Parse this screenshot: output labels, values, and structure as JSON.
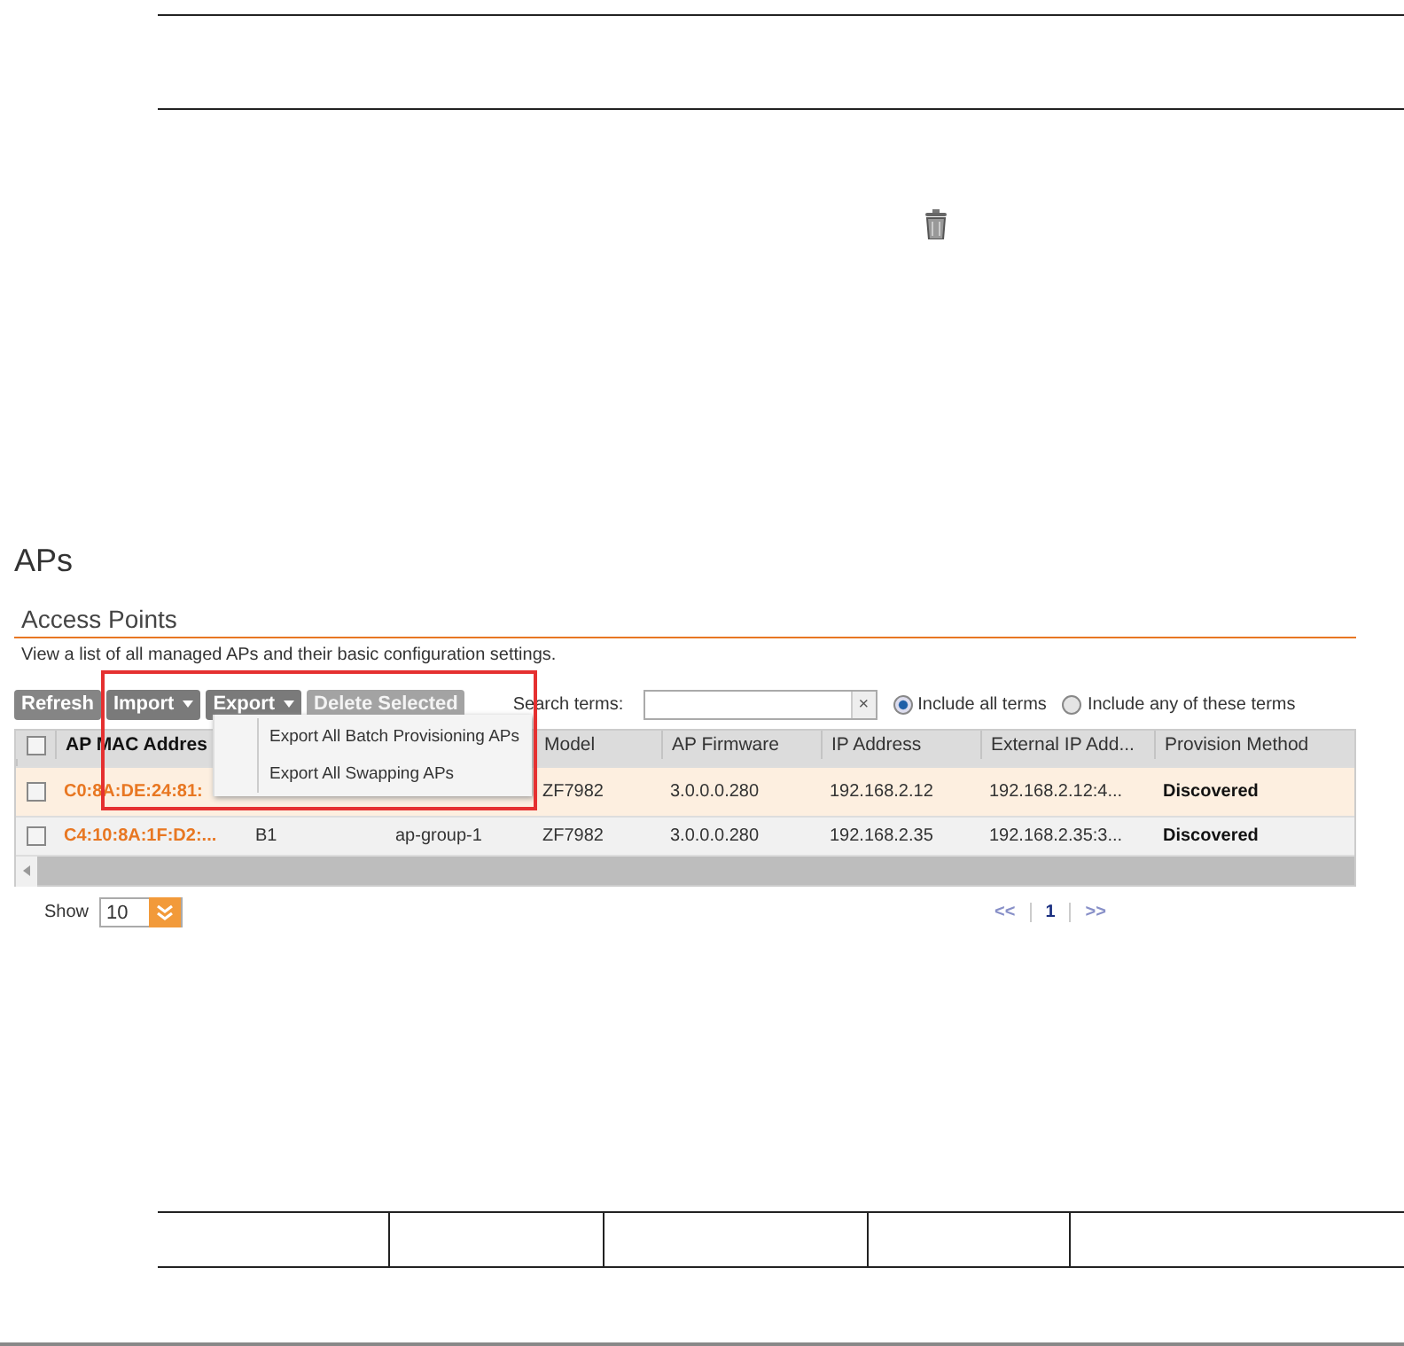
{
  "page_title": "APs",
  "section": {
    "title": "Access Points",
    "description": "View a list of all managed APs and their basic configuration settings."
  },
  "toolbar": {
    "buttons": [
      {
        "label": "Refresh",
        "has_menu": false,
        "disabled": false
      },
      {
        "label": "Import",
        "has_menu": true,
        "disabled": false
      },
      {
        "label": "Export",
        "has_menu": true,
        "disabled": false
      },
      {
        "label": "Delete Selected",
        "has_menu": false,
        "disabled": true
      }
    ],
    "search_label": "Search terms:",
    "clear": "×",
    "options": [
      {
        "label": "Include all terms",
        "selected": true
      },
      {
        "label": "Include any of these terms",
        "selected": false
      }
    ]
  },
  "export_menu": {
    "items": [
      "Export All Batch Provisioning APs",
      "Export All Swapping APs"
    ]
  },
  "table": {
    "header_checked": false,
    "columns": [
      {
        "label": "AP MAC Addres"
      },
      {},
      {},
      {
        "label": "Model"
      },
      {
        "label": "AP Firmware"
      },
      {
        "label": "IP Address"
      },
      {
        "label": "External IP Add..."
      },
      {
        "label": "Provision Method"
      }
    ],
    "rows": [
      {
        "selected": true,
        "checked": false,
        "cells": [
          "C0:8A:DE:24:81:",
          null,
          null,
          "ZF7982",
          "3.0.0.0.280",
          "192.168.2.12",
          "192.168.2.12:4...",
          "Discovered"
        ]
      },
      {
        "selected": false,
        "checked": false,
        "cells": [
          "C4:10:8A:1F:D2:...",
          "B1",
          "ap-group-1",
          "ZF7982",
          "3.0.0.0.280",
          "192.168.2.35",
          "192.168.2.35:3...",
          "Discovered"
        ]
      }
    ]
  },
  "footer": {
    "show_label": "Show",
    "page_size": "10",
    "pager": {
      "prev": "<<",
      "pages": [
        {
          "label": "1",
          "selected": true
        }
      ],
      "next": ">>"
    }
  }
}
